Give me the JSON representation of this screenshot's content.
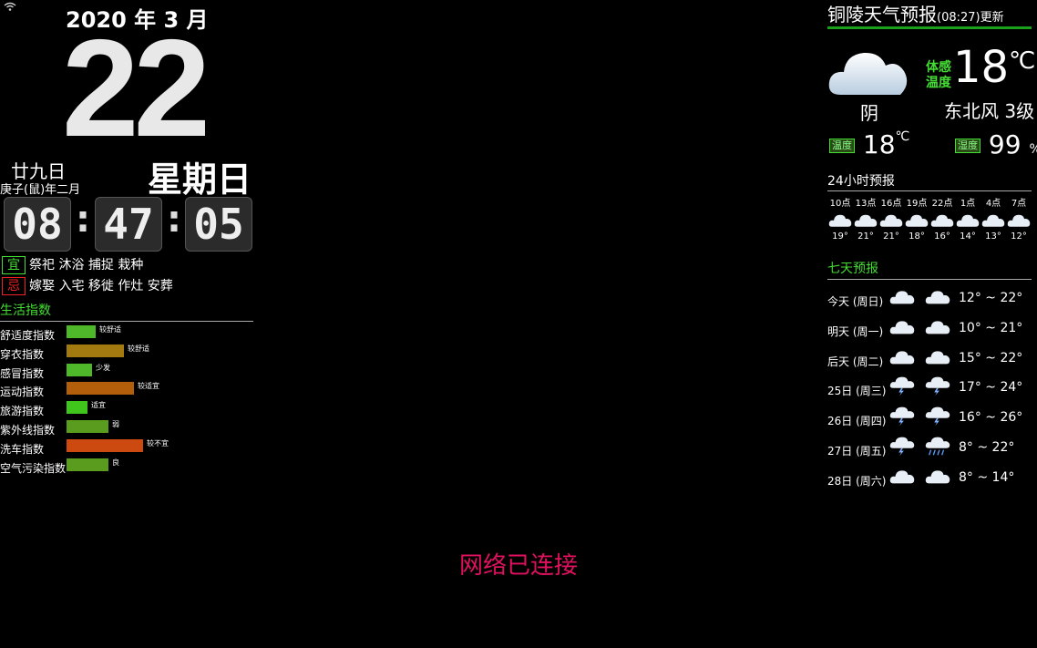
{
  "left": {
    "year_month": "2020 年 3 月",
    "day": "22",
    "lunar_day": "廿九日",
    "ganzhi": "庚子(鼠)年二月",
    "weekday": "星期日",
    "time": {
      "h": "08",
      "m": "47",
      "s": "05",
      "sep": ":"
    },
    "yi": {
      "tag": "宜",
      "text": "祭祀 沐浴 捕捉 栽种"
    },
    "ji": {
      "tag": "忌",
      "text": "嫁娶 入宅 移徙 作灶 安葬"
    },
    "life_header": "生活指数",
    "life": [
      {
        "name": "舒适度指数",
        "value": "较舒适",
        "level": 0.36,
        "color": "#4fb82a"
      },
      {
        "name": "穿衣指数",
        "value": "较舒适",
        "level": 0.72,
        "color": "#a27a10"
      },
      {
        "name": "感冒指数",
        "value": "少发",
        "level": 0.32,
        "color": "#4fb82a"
      },
      {
        "name": "运动指数",
        "value": "较适宜",
        "level": 0.84,
        "color": "#b35e0a"
      },
      {
        "name": "旅游指数",
        "value": "适宜",
        "level": 0.26,
        "color": "#3fc51c"
      },
      {
        "name": "紫外线指数",
        "value": "弱",
        "level": 0.52,
        "color": "#5a9c1e"
      },
      {
        "name": "洗车指数",
        "value": "较不宜",
        "level": 0.96,
        "color": "#cc4a10"
      },
      {
        "name": "空气污染指数",
        "value": "良",
        "level": 0.52,
        "color": "#5a9c1e"
      }
    ]
  },
  "right": {
    "city_title": "铜陵天气预报",
    "update": "(08:27)更新",
    "feels_label_1": "体感",
    "feels_label_2": "温度",
    "feels_temp": "18",
    "unit_c": "℃",
    "condition": "阴",
    "wind": "东北风 3级",
    "temp_tag": "温度",
    "temp_value": "18",
    "hum_tag": "湿度",
    "hum_value": "99",
    "hum_unit": "%",
    "hourly_header": "24小时预报",
    "hourly": [
      {
        "t": "10点",
        "temp": "19°",
        "icon": "cloud-icon"
      },
      {
        "t": "13点",
        "temp": "21°",
        "icon": "cloud-icon"
      },
      {
        "t": "16点",
        "temp": "21°",
        "icon": "cloud-icon"
      },
      {
        "t": "19点",
        "temp": "18°",
        "icon": "cloud-icon"
      },
      {
        "t": "22点",
        "temp": "16°",
        "icon": "cloud-icon"
      },
      {
        "t": "1点",
        "temp": "14°",
        "icon": "cloud-icon"
      },
      {
        "t": "4点",
        "temp": "13°",
        "icon": "cloud-icon"
      },
      {
        "t": "7点",
        "temp": "12°",
        "icon": "cloud-icon"
      }
    ],
    "daily_header": "七天预报",
    "daily": [
      {
        "label": "今天 (周日)",
        "icon1": "cloud-icon",
        "icon2": "cloud-icon",
        "range": "12° ~ 22°"
      },
      {
        "label": "明天 (周一)",
        "icon1": "cloud-icon",
        "icon2": "cloud-icon",
        "range": "10° ~ 21°"
      },
      {
        "label": "后天 (周二)",
        "icon1": "cloud-icon",
        "icon2": "cloud-icon",
        "range": "15° ~ 22°"
      },
      {
        "label": "25日 (周三)",
        "icon1": "thunder-icon",
        "icon2": "thunder-icon",
        "range": "17° ~ 24°"
      },
      {
        "label": "26日 (周四)",
        "icon1": "thunder-icon",
        "icon2": "thunder-icon",
        "range": "16° ~ 26°"
      },
      {
        "label": "27日 (周五)",
        "icon1": "thunder-icon",
        "icon2": "rain-icon",
        "range": "8° ~ 22°"
      },
      {
        "label": "28日 (周六)",
        "icon1": "cloud-icon",
        "icon2": "cloud-icon",
        "range": "8° ~ 14°"
      }
    ]
  },
  "network_status": "网络已连接",
  "colors": {
    "green": "#44dd33",
    "red": "#e0115f",
    "yi": "#44dd33",
    "ji": "#ee2222"
  }
}
